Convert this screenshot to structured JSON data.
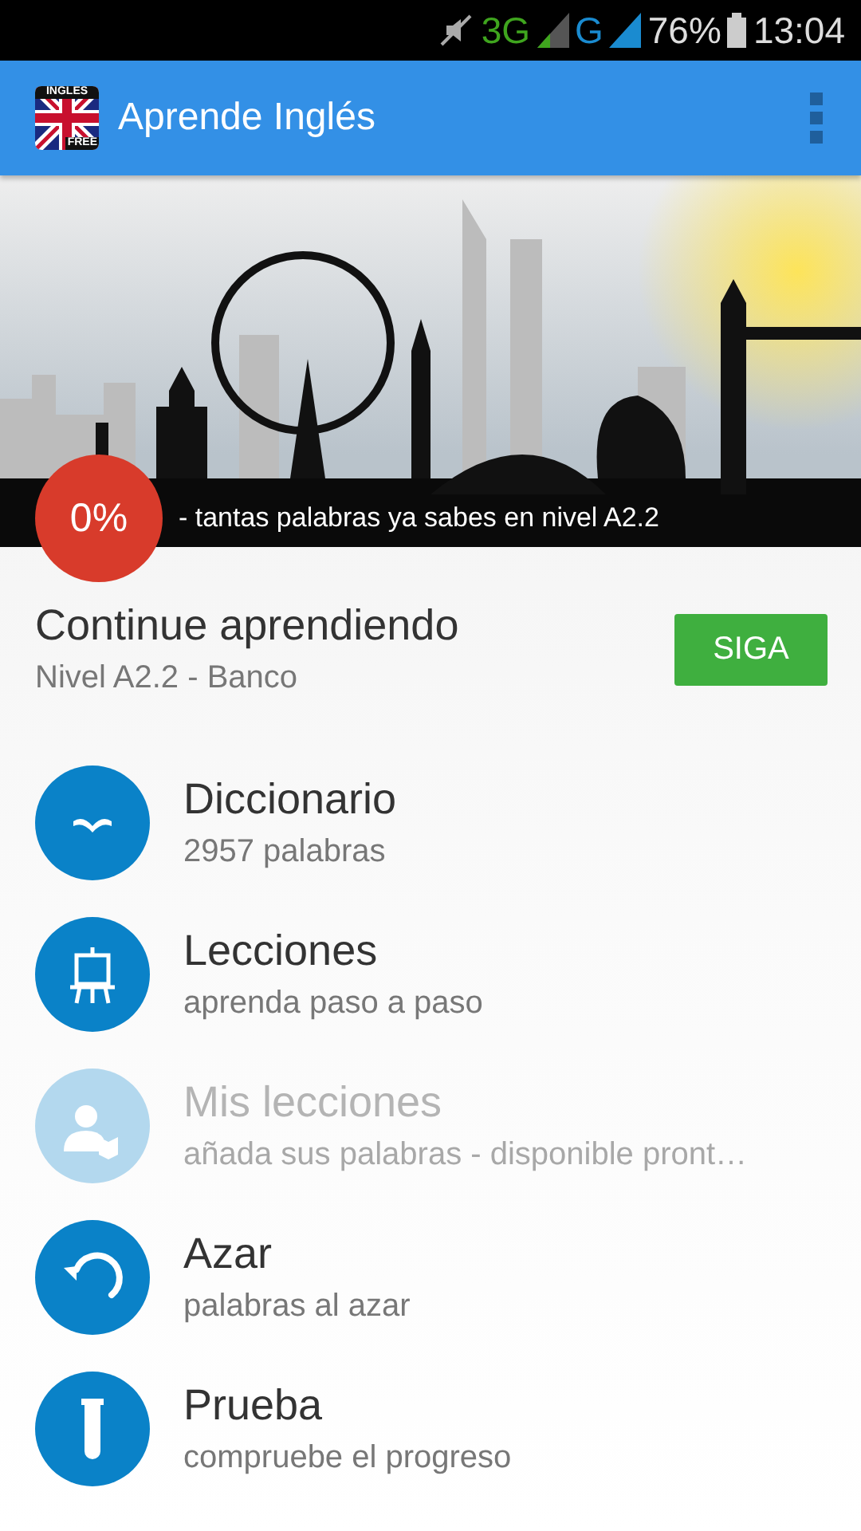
{
  "status_bar": {
    "network_1": "3G",
    "network_2": "G",
    "battery": "76%",
    "time": "13:04"
  },
  "app_bar": {
    "logo_top": "INGLES",
    "logo_bottom": "FREE",
    "title": "Aprende Inglés"
  },
  "banner": {
    "progress": "0%",
    "caption": "- tantas palabras ya sabes en nivel A2.2"
  },
  "continue": {
    "title": "Continue aprendiendo",
    "subtitle": "Nivel A2.2 - Banco",
    "button": "SIGA"
  },
  "menu": [
    {
      "kind": "book",
      "title": "Diccionario",
      "subtitle": "2957 palabras",
      "disabled": false
    },
    {
      "kind": "easel",
      "title": "Lecciones",
      "subtitle": "aprenda paso a paso",
      "disabled": false
    },
    {
      "kind": "person",
      "title": "Mis lecciones",
      "subtitle": "añada sus palabras - disponible pront…",
      "disabled": true
    },
    {
      "kind": "undo",
      "title": "Azar",
      "subtitle": "palabras al azar",
      "disabled": false
    },
    {
      "kind": "tube",
      "title": "Prueba",
      "subtitle": "compruebe el progreso",
      "disabled": false
    }
  ]
}
